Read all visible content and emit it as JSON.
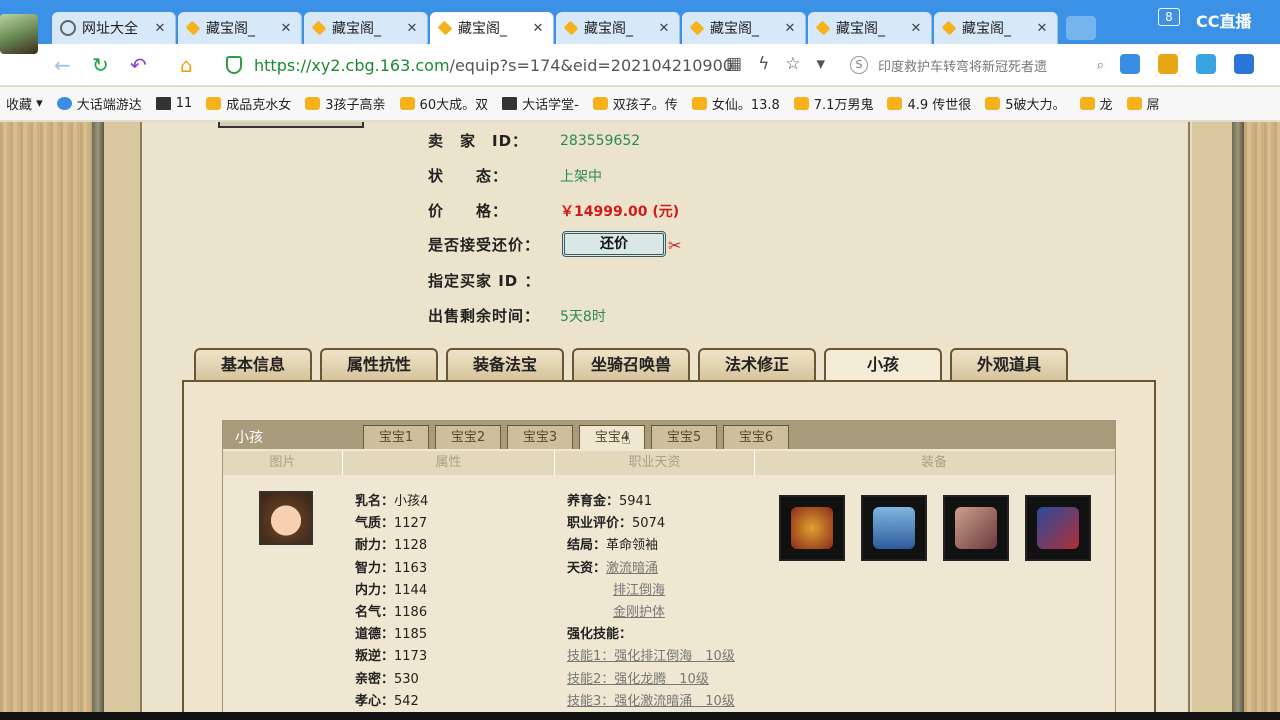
{
  "browser": {
    "tabs": [
      {
        "label": "网址大全",
        "icon": "globe-icon"
      },
      {
        "label": "藏宝阁_",
        "icon": "cbg-icon"
      },
      {
        "label": "藏宝阁_",
        "icon": "cbg-icon"
      },
      {
        "label": "藏宝阁_",
        "icon": "cbg-icon",
        "active": true
      },
      {
        "label": "藏宝阁_",
        "icon": "cbg-icon"
      },
      {
        "label": "藏宝阁_",
        "icon": "cbg-icon"
      },
      {
        "label": "藏宝阁_",
        "icon": "cbg-icon"
      },
      {
        "label": "藏宝阁_",
        "icon": "cbg-icon"
      }
    ],
    "tab_count": "8",
    "cc_logo": "CC直播",
    "url_domain": "https://xy2.cbg.163.com",
    "url_rest": "/equip?s=174&eid=202104210900",
    "search_text": "印度救护车转弯将新冠死者遗",
    "bookmarks": [
      "收藏",
      "大话端游达",
      "11",
      "成品克水女",
      "3孩子高亲",
      "60大成。双",
      "大话学堂-",
      "双孩子。传",
      "女仙。13.8",
      "7.1万男鬼",
      "4.9 传世很",
      "5破大力。",
      "龙",
      "屌"
    ]
  },
  "seller": {
    "id_label": "卖　家　ID：",
    "id_value": "283559652",
    "status_label": "状　　态：",
    "status_value": "上架中",
    "price_label": "价　　格：",
    "price_value": "￥14999.00 (元)",
    "counter_label": "是否接受还价：",
    "counter_button": "还价",
    "buyer_label": "指定买家 ID ：",
    "time_label": "出售剩余时间：",
    "time_value": "5天8时"
  },
  "main_tabs": [
    "基本信息",
    "属性抗性",
    "装备法宝",
    "坐骑召唤兽",
    "法术修正",
    "小孩",
    "外观道具"
  ],
  "child_panel": {
    "title": "小孩",
    "sub_tabs": [
      "宝宝1",
      "宝宝2",
      "宝宝3",
      "宝宝4",
      "宝宝5",
      "宝宝6"
    ],
    "columns": [
      "图片",
      "属性",
      "职业天资",
      "装备"
    ],
    "attributes": [
      {
        "k": "乳名：",
        "v": "小孩4"
      },
      {
        "k": "气质：",
        "v": "1127"
      },
      {
        "k": "耐力：",
        "v": "1128"
      },
      {
        "k": "智力：",
        "v": "1163"
      },
      {
        "k": "内力：",
        "v": "1144"
      },
      {
        "k": "名气：",
        "v": "1186"
      },
      {
        "k": "道德：",
        "v": "1185"
      },
      {
        "k": "叛逆：",
        "v": "1173"
      },
      {
        "k": "亲密：",
        "v": "530"
      },
      {
        "k": "孝心：",
        "v": "542"
      }
    ],
    "growth": {
      "fund_label": "养育金：",
      "fund": "5941",
      "score_label": "职业评价：",
      "score": "5074",
      "ending_label": "结局：",
      "ending": "革命领袖",
      "talent_label": "天资：",
      "talents": [
        "激流暗涌",
        "排江倒海",
        "金刚护体"
      ],
      "skill_label": "强化技能：",
      "skills": [
        "技能1：强化排江倒海　10级",
        "技能2：强化龙腾　10级",
        "技能3：强化激流暗涌　10级"
      ]
    }
  }
}
